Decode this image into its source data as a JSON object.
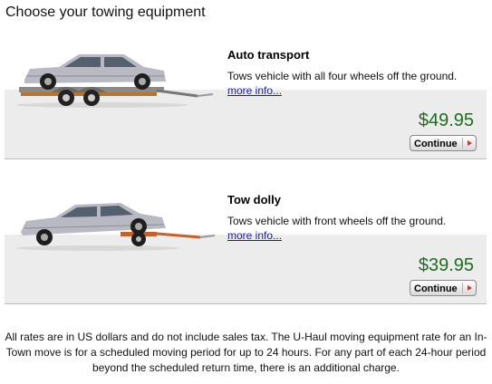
{
  "page": {
    "title": "Choose your towing equipment"
  },
  "options": [
    {
      "name": "Auto transport",
      "description": "Tows vehicle with all four wheels off the ground.",
      "more_link": "more info...",
      "price": "$49.95",
      "button": "Continue"
    },
    {
      "name": "Tow dolly",
      "description": "Tows vehicle with front wheels off the ground.",
      "more_link": "more info...",
      "price": "$39.95",
      "button": "Continue"
    }
  ],
  "footer": "All rates are in US dollars and do not include sales tax. The U-Haul moving equipment rate for an In-Town move is for a scheduled moving period for up to 24 hours. For any part of each 24-hour period beyond the scheduled return time, there is an additional charge.",
  "colors": {
    "price": "#1c6e1c",
    "link": "#1a1aa6",
    "button_arrow": "#c0392b"
  }
}
